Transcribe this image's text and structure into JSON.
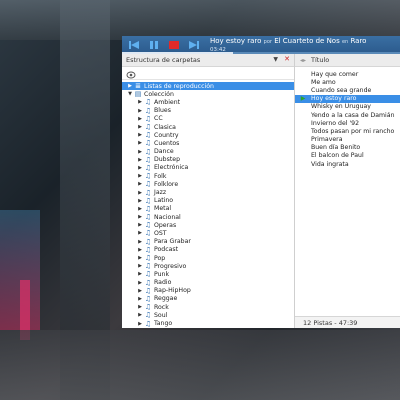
{
  "colors": {
    "accent": "#3a8ee6",
    "player_bar": "#2b5a8c",
    "stop_red": "#e02a2a",
    "playing_marker": "#2aa52a"
  },
  "player": {
    "track_title": "Hoy estoy raro",
    "by_label": "por",
    "artist": "El Cuarteto de Nos",
    "on_label": "en",
    "album": "Raro",
    "elapsed": "03:42",
    "progress_fraction": 0.4,
    "controls": [
      "previous-icon",
      "pause-icon",
      "stop-icon",
      "next-icon"
    ]
  },
  "left_pane": {
    "title": "Estructura de carpetas",
    "filter_icon": "filter-icon",
    "playlists_label": "Listas de reproducción",
    "collection_label": "Colección",
    "folders": [
      "Ambient",
      "Blues",
      "CC",
      "Clasica",
      "Country",
      "Cuentos",
      "Dance",
      "Dubstep",
      "Electrónica",
      "Folk",
      "Folklore",
      "Jazz",
      "Latino",
      "Metal",
      "Nacional",
      "Operas",
      "OST",
      "Para Grabar",
      "Podcast",
      "Pop",
      "Progresivo",
      "Punk",
      "Radio",
      "Rap-HipHop",
      "Reggae",
      "Rock",
      "Soul",
      "Tango"
    ]
  },
  "right_pane": {
    "column_header": "Título",
    "tracks": [
      "Hay que comer",
      "Me amo",
      "Cuando sea grande",
      "Hoy estoy raro",
      "Whisky en Uruguay",
      "Yendo a la casa de Damián",
      "Invierno del '92",
      "Todos pasan por mi rancho",
      "Primavera",
      "Buen día Benito",
      "El balcon de Paul",
      "Vida ingrata"
    ],
    "playing_index": 3,
    "footer": "12 Pistas - 47:39"
  }
}
